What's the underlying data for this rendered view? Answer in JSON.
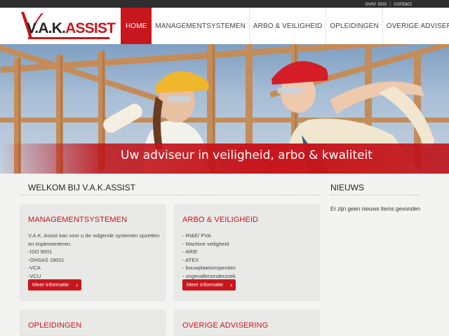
{
  "topbar": {
    "links": [
      "over ons",
      "contact"
    ],
    "separator": "|"
  },
  "logo": {
    "text_dark": "V.A.K.",
    "text_red": "ASSIST"
  },
  "nav": [
    {
      "label": "HOME",
      "active": true
    },
    {
      "label": "MANAGEMENTSYSTEMEN",
      "active": false
    },
    {
      "label": "ARBO & VEILIGHEID",
      "active": false
    },
    {
      "label": "OPLEIDINGEN",
      "active": false
    },
    {
      "label": "OVERIGE ADVISERING",
      "active": false
    }
  ],
  "hero": {
    "slogan": "Uw adviseur in veiligheid, arbo & kwaliteit"
  },
  "main": {
    "title": "WELKOM BIJ V.A.K.ASSIST"
  },
  "sidebar": {
    "title": "NIEUWS",
    "empty_text": "Er zijn geen nieuws items gevonden"
  },
  "cards": [
    {
      "title": "MANAGEMENTSYSTEMEN",
      "lines": [
        "V.A.K. Assist kan voor u de volgende systemen opzetten en implementeren.",
        "-ISO 9001",
        "-OHSAS 18001",
        "-VCA",
        "-VCU"
      ],
      "button": "Meer informatie"
    },
    {
      "title": "ARBO & VEILIGHEID",
      "lines": [
        "- RI&E/ PVA",
        "- Machine veiligheid",
        "- ARIE",
        "- ATEX",
        "- bouwplaatsinspecties",
        "- ongevallenonderzoek"
      ],
      "button": "Meer informatie"
    },
    {
      "title": "OPLEIDINGEN"
    },
    {
      "title": "OVERIGE ADVISERING"
    }
  ],
  "colors": {
    "brand_red": "#c8161d",
    "topbar": "#2e2e2e",
    "page_bg": "#f3f3f1"
  },
  "icons": {
    "button_chevron": "chevron-right-icon",
    "chevron_glyph": "›"
  }
}
